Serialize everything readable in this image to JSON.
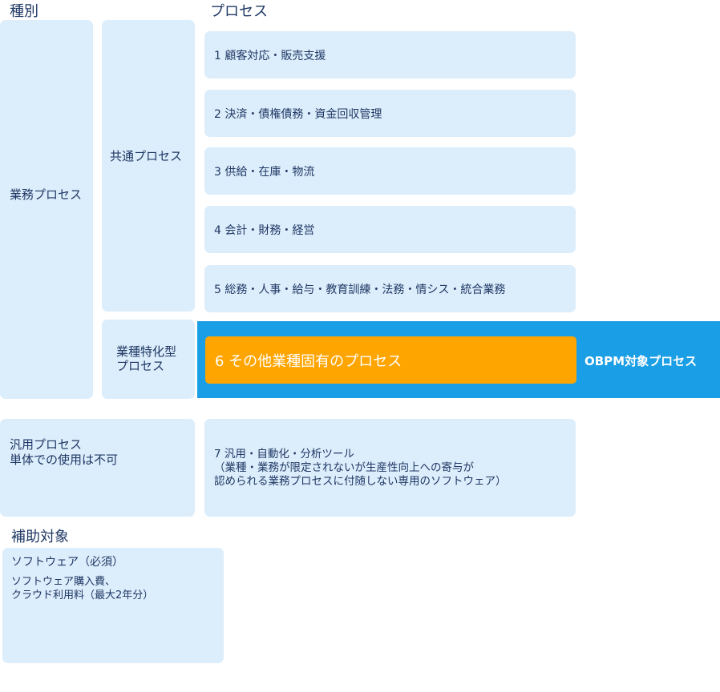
{
  "headers": {
    "category": "種別",
    "process": "プロセス",
    "subsidy": "補助対象"
  },
  "business_process": {
    "label": "業務プロセス",
    "common": {
      "label": "共通プロセス",
      "items": [
        "1 顧客対応・販売支援",
        "2 決済・債権債務・資金回収管理",
        "3 供給・在庫・物流",
        "4 会計・財務・経営",
        "5 総務・人事・給与・教育訓練・法務・情シス・統合業務"
      ]
    },
    "industry_specific": {
      "label": "業種特化型\nプロセス",
      "item": "6 その他業種固有のプロセス",
      "obpm_label": "OBPM対象プロセス"
    }
  },
  "general_process": {
    "label": "汎用プロセス\n単体での使用は不可",
    "item": "7 汎用・自動化・分析ツール\n（業種・業務が限定されないが生産性向上への寄与が\n認められる業務プロセスに付随しない専用のソフトウェア）"
  },
  "subsidy": {
    "title": "ソフトウェア（必須）",
    "detail": "ソフトウェア購入費、\nクラウド利用料（最大2年分）"
  },
  "colors": {
    "box": "#dcedfb",
    "blue_band": "#1a9ee5",
    "orange": "#ffa500",
    "text": "#1f3864"
  }
}
